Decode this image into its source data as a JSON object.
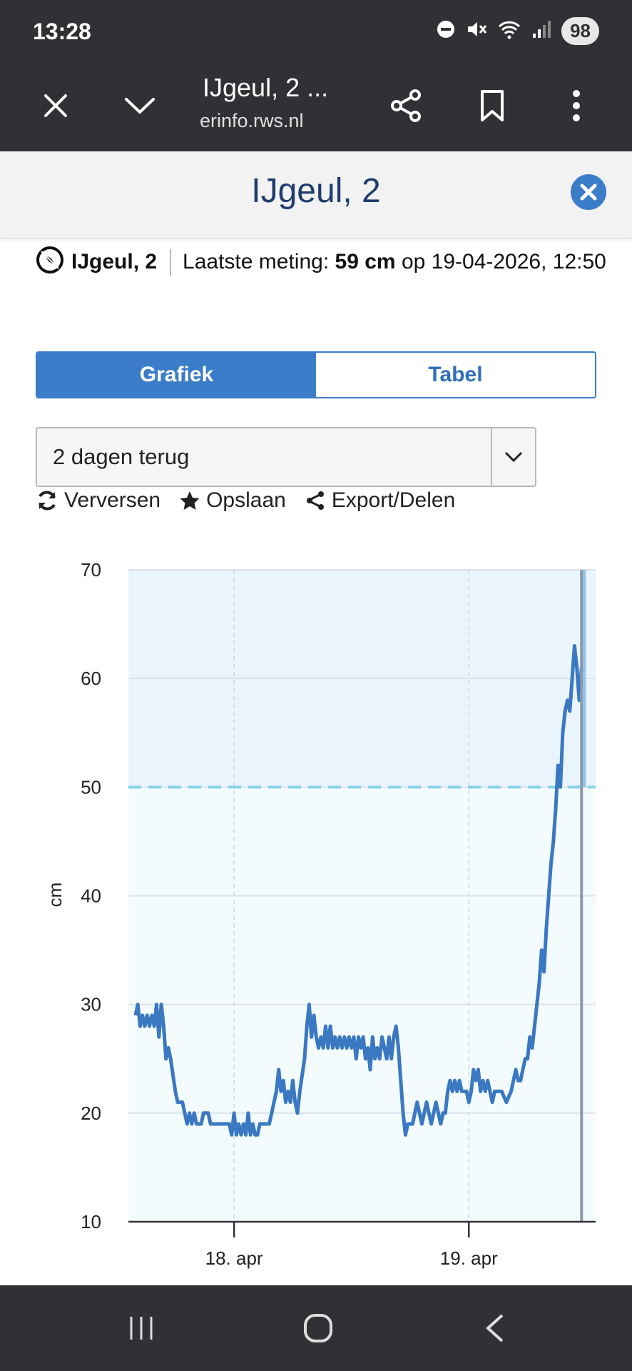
{
  "status_bar": {
    "time": "13:28",
    "battery": "98",
    "icons": [
      "do-not-disturb-icon",
      "mute-icon",
      "wifi-icon",
      "signal-icon"
    ]
  },
  "browser_toolbar": {
    "title": "IJgeul, 2 ...",
    "url": "erinfo.rws.nl",
    "icons": [
      "close-icon",
      "chevron-down-icon",
      "share-icon",
      "bookmark-icon",
      "more-icon"
    ]
  },
  "panel": {
    "title": "IJgeul, 2"
  },
  "info": {
    "location": "IJgeul, 2",
    "last_label": "Laatste meting:",
    "value": "59 cm",
    "op": "op",
    "datetime": "19-04-2026, 12:50"
  },
  "tabs": [
    {
      "label": "Grafiek",
      "active": true
    },
    {
      "label": "Tabel",
      "active": false
    }
  ],
  "range_select": {
    "value": "2 dagen terug"
  },
  "actions": {
    "refresh": "Verversen",
    "save": "Opslaan",
    "export": "Export/Delen"
  },
  "colors": {
    "accent": "#3b7dc8",
    "line": "#3a78c2",
    "threshold": "#86d3ea",
    "plot_bg_upper": "#eaf4fd",
    "plot_bg_lower": "#f3fbfd",
    "bars": "#303134"
  },
  "chart_data": {
    "type": "line",
    "ylabel": "cm",
    "ylim": [
      10,
      70
    ],
    "yticks": [
      10,
      20,
      30,
      40,
      50,
      60,
      70
    ],
    "xlim": [
      -0.45,
      1.54
    ],
    "xticks": [
      {
        "x": 0,
        "label": "18. apr"
      },
      {
        "x": 1,
        "label": "19. apr"
      }
    ],
    "threshold": 50,
    "grid": true,
    "series": [
      {
        "points": [
          [
            -0.42,
            29
          ],
          [
            -0.41,
            30
          ],
          [
            -0.4,
            28
          ],
          [
            -0.39,
            29
          ],
          [
            -0.38,
            28
          ],
          [
            -0.37,
            29
          ],
          [
            -0.36,
            28
          ],
          [
            -0.35,
            29
          ],
          [
            -0.34,
            28
          ],
          [
            -0.33,
            30
          ],
          [
            -0.32,
            27
          ],
          [
            -0.31,
            30
          ],
          [
            -0.3,
            28
          ],
          [
            -0.29,
            25
          ],
          [
            -0.28,
            26
          ],
          [
            -0.27,
            25
          ],
          [
            -0.25,
            22
          ],
          [
            -0.24,
            21
          ],
          [
            -0.22,
            21
          ],
          [
            -0.21,
            20
          ],
          [
            -0.2,
            19
          ],
          [
            -0.19,
            20
          ],
          [
            -0.18,
            19
          ],
          [
            -0.17,
            20
          ],
          [
            -0.16,
            19
          ],
          [
            -0.14,
            19
          ],
          [
            -0.13,
            20
          ],
          [
            -0.11,
            20
          ],
          [
            -0.1,
            19
          ],
          [
            -0.08,
            19
          ],
          [
            -0.05,
            19
          ],
          [
            -0.02,
            19
          ],
          [
            -0.01,
            18
          ],
          [
            0.0,
            20
          ],
          [
            0.01,
            18
          ],
          [
            0.02,
            19
          ],
          [
            0.03,
            18
          ],
          [
            0.04,
            19
          ],
          [
            0.05,
            18
          ],
          [
            0.06,
            20
          ],
          [
            0.07,
            18
          ],
          [
            0.08,
            19
          ],
          [
            0.09,
            18
          ],
          [
            0.1,
            18
          ],
          [
            0.11,
            19
          ],
          [
            0.13,
            19
          ],
          [
            0.15,
            19
          ],
          [
            0.17,
            21
          ],
          [
            0.18,
            22
          ],
          [
            0.19,
            24
          ],
          [
            0.2,
            22
          ],
          [
            0.21,
            23
          ],
          [
            0.22,
            21
          ],
          [
            0.23,
            22
          ],
          [
            0.24,
            21
          ],
          [
            0.25,
            23
          ],
          [
            0.26,
            21
          ],
          [
            0.27,
            20
          ],
          [
            0.28,
            22
          ],
          [
            0.3,
            25
          ],
          [
            0.31,
            28
          ],
          [
            0.32,
            30
          ],
          [
            0.33,
            27
          ],
          [
            0.34,
            29
          ],
          [
            0.35,
            27
          ],
          [
            0.36,
            26
          ],
          [
            0.37,
            27
          ],
          [
            0.38,
            26
          ],
          [
            0.39,
            28
          ],
          [
            0.4,
            26
          ],
          [
            0.41,
            28
          ],
          [
            0.42,
            26
          ],
          [
            0.43,
            27
          ],
          [
            0.44,
            26
          ],
          [
            0.45,
            27
          ],
          [
            0.46,
            26
          ],
          [
            0.47,
            27
          ],
          [
            0.48,
            26
          ],
          [
            0.49,
            27
          ],
          [
            0.5,
            26
          ],
          [
            0.51,
            27
          ],
          [
            0.52,
            25
          ],
          [
            0.53,
            27
          ],
          [
            0.54,
            26
          ],
          [
            0.55,
            27
          ],
          [
            0.56,
            25
          ],
          [
            0.57,
            26
          ],
          [
            0.58,
            24
          ],
          [
            0.59,
            27
          ],
          [
            0.6,
            25
          ],
          [
            0.61,
            26
          ],
          [
            0.62,
            25
          ],
          [
            0.63,
            27
          ],
          [
            0.64,
            26
          ],
          [
            0.65,
            25
          ],
          [
            0.66,
            27
          ],
          [
            0.67,
            25
          ],
          [
            0.68,
            27
          ],
          [
            0.69,
            28
          ],
          [
            0.7,
            26
          ],
          [
            0.71,
            23
          ],
          [
            0.72,
            20
          ],
          [
            0.73,
            18
          ],
          [
            0.74,
            19
          ],
          [
            0.76,
            19
          ],
          [
            0.77,
            20
          ],
          [
            0.78,
            21
          ],
          [
            0.79,
            20
          ],
          [
            0.8,
            19
          ],
          [
            0.81,
            20
          ],
          [
            0.82,
            21
          ],
          [
            0.83,
            20
          ],
          [
            0.84,
            19
          ],
          [
            0.85,
            20
          ],
          [
            0.86,
            21
          ],
          [
            0.87,
            20
          ],
          [
            0.88,
            19
          ],
          [
            0.89,
            20
          ],
          [
            0.9,
            20
          ],
          [
            0.91,
            22
          ],
          [
            0.92,
            23
          ],
          [
            0.93,
            22
          ],
          [
            0.94,
            23
          ],
          [
            0.95,
            22
          ],
          [
            0.96,
            23
          ],
          [
            0.97,
            22
          ],
          [
            0.98,
            22
          ],
          [
            0.99,
            22
          ],
          [
            1.0,
            21
          ],
          [
            1.01,
            22
          ],
          [
            1.02,
            24
          ],
          [
            1.03,
            23
          ],
          [
            1.04,
            24
          ],
          [
            1.05,
            22
          ],
          [
            1.06,
            23
          ],
          [
            1.07,
            22
          ],
          [
            1.08,
            23
          ],
          [
            1.09,
            22
          ],
          [
            1.1,
            21
          ],
          [
            1.11,
            22
          ],
          [
            1.12,
            22
          ],
          [
            1.14,
            22
          ],
          [
            1.16,
            21
          ],
          [
            1.18,
            22
          ],
          [
            1.2,
            24
          ],
          [
            1.21,
            23
          ],
          [
            1.22,
            23
          ],
          [
            1.23,
            24
          ],
          [
            1.24,
            25
          ],
          [
            1.25,
            25
          ],
          [
            1.26,
            27
          ],
          [
            1.27,
            26
          ],
          [
            1.28,
            28
          ],
          [
            1.29,
            30
          ],
          [
            1.3,
            32
          ],
          [
            1.31,
            35
          ],
          [
            1.32,
            33
          ],
          [
            1.33,
            37
          ],
          [
            1.34,
            40
          ],
          [
            1.35,
            43
          ],
          [
            1.36,
            45
          ],
          [
            1.37,
            48
          ],
          [
            1.38,
            52
          ],
          [
            1.39,
            50
          ],
          [
            1.4,
            55
          ],
          [
            1.41,
            57
          ],
          [
            1.42,
            58
          ],
          [
            1.43,
            57
          ],
          [
            1.44,
            60
          ],
          [
            1.45,
            63
          ],
          [
            1.46,
            61
          ],
          [
            1.47,
            58
          ],
          [
            1.48,
            61
          ]
        ]
      }
    ]
  }
}
